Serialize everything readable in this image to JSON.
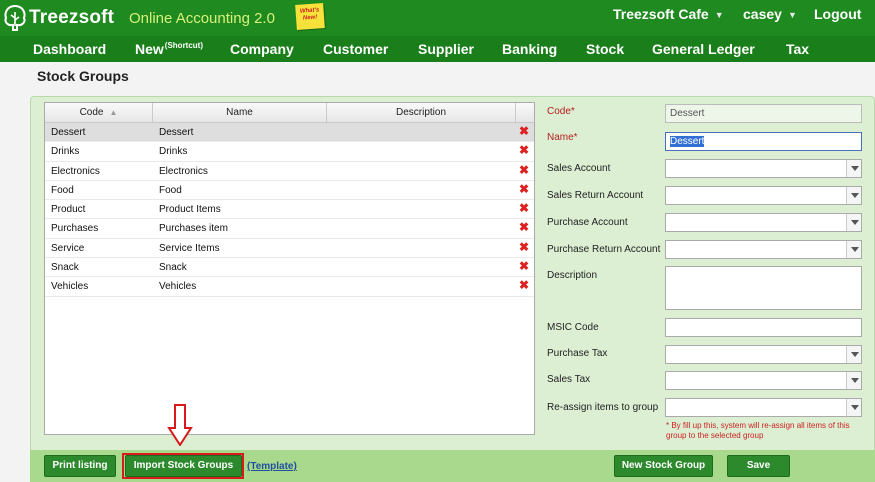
{
  "header": {
    "brand": "Treezsoft",
    "tagline": "Online Accounting 2.0",
    "whats_new": "What's New!",
    "company": "Treezsoft Cafe",
    "user": "casey",
    "logout": "Logout"
  },
  "nav": {
    "items": [
      "Dashboard",
      "New",
      "Company",
      "Customer",
      "Supplier",
      "Banking",
      "Stock",
      "General Ledger",
      "Tax"
    ],
    "new_sup": "(Shortcut)"
  },
  "page": {
    "title": "Stock Groups"
  },
  "grid": {
    "columns": [
      "Code",
      "Name",
      "Description"
    ],
    "rows": [
      {
        "code": "Dessert",
        "name": "Dessert"
      },
      {
        "code": "Drinks",
        "name": "Drinks"
      },
      {
        "code": "Electronics",
        "name": "Electronics"
      },
      {
        "code": "Food",
        "name": "Food"
      },
      {
        "code": "Product",
        "name": "Product Items"
      },
      {
        "code": "Purchases",
        "name": "Purchases item"
      },
      {
        "code": "Service",
        "name": "Service Items"
      },
      {
        "code": "Snack",
        "name": "Snack"
      },
      {
        "code": "Vehicles",
        "name": "Vehicles"
      }
    ],
    "delete_glyph": "✖"
  },
  "form": {
    "code_label": "Code*",
    "code_value": "Dessert",
    "name_label": "Name*",
    "name_value": "Dessert",
    "sales_account": "Sales Account",
    "sales_return_account": "Sales Return Account",
    "purchase_account": "Purchase Account",
    "purchase_return_account": "Purchase Return Account",
    "description": "Description",
    "msic_code": "MSIC Code",
    "purchase_tax": "Purchase Tax",
    "sales_tax": "Sales Tax",
    "reassign": "Re-assign items to group",
    "reassign_note": "* By fill up this, system will re-assign all items of this group to the selected group"
  },
  "actions": {
    "print": "Print listing",
    "import": "Import Stock Groups",
    "template": "(Template)",
    "new_group": "New Stock Group",
    "save": "Save"
  }
}
